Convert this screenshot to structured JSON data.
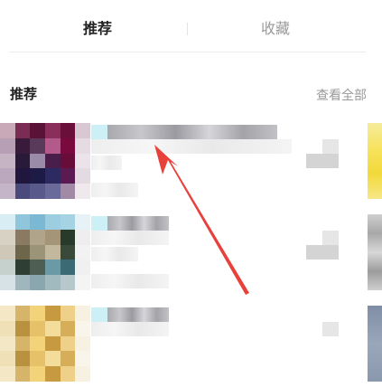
{
  "tabs": [
    {
      "label": "推荐",
      "active": true
    },
    {
      "label": "收藏",
      "active": false
    }
  ],
  "section": {
    "title": "推荐",
    "view_all": "查看全部"
  },
  "annotation": {
    "arrow_color": "#e8403a"
  }
}
